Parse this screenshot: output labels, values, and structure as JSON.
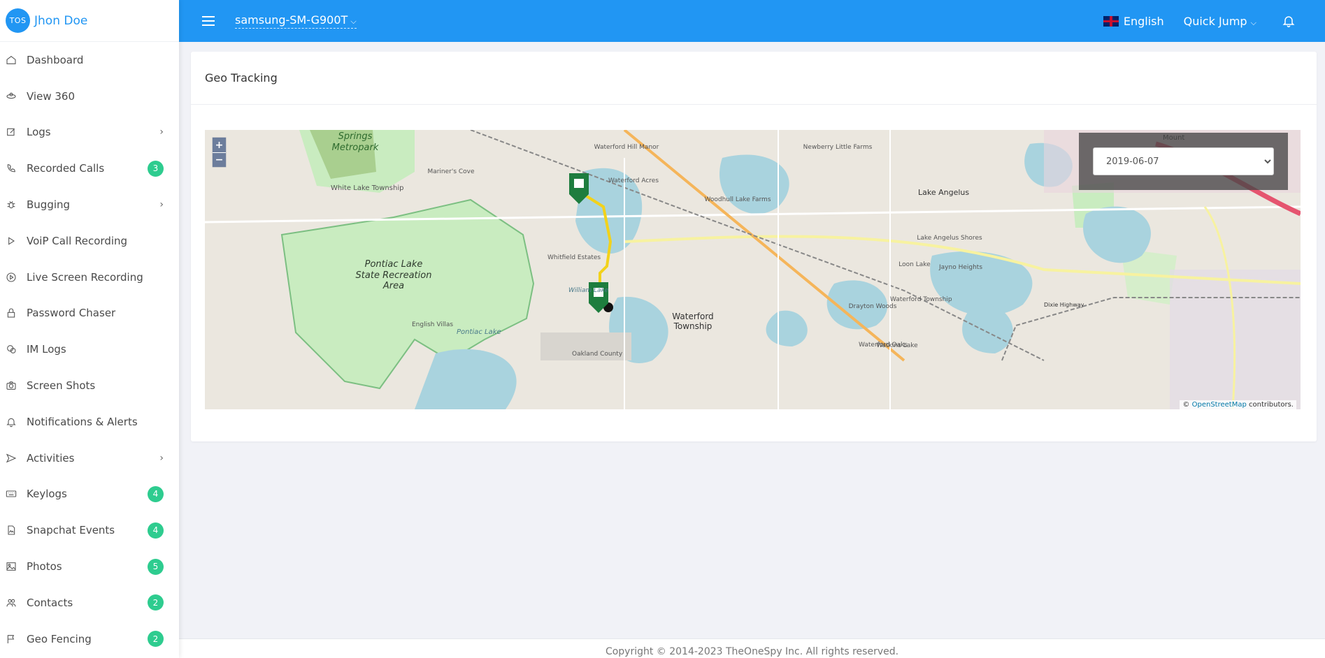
{
  "brand": {
    "logo_text": "TOS",
    "user_name": "Jhon Doe"
  },
  "sidebar": {
    "items": [
      {
        "label": "Dashboard",
        "icon": "home-icon",
        "badge": "",
        "arrow": false
      },
      {
        "label": "View 360",
        "icon": "view360-icon",
        "badge": "",
        "arrow": false
      },
      {
        "label": "Logs",
        "icon": "edit-icon",
        "badge": "",
        "arrow": true
      },
      {
        "label": "Recorded Calls",
        "icon": "phone-icon",
        "badge": "3",
        "arrow": false
      },
      {
        "label": "Bugging",
        "icon": "bug-icon",
        "badge": "",
        "arrow": true
      },
      {
        "label": "VoiP Call Recording",
        "icon": "play-icon",
        "badge": "",
        "arrow": false
      },
      {
        "label": "Live Screen Recording",
        "icon": "play-circle-icon",
        "badge": "",
        "arrow": false
      },
      {
        "label": "Password Chaser",
        "icon": "lock-icon",
        "badge": "",
        "arrow": false
      },
      {
        "label": "IM Logs",
        "icon": "chat-icon",
        "badge": "",
        "arrow": false
      },
      {
        "label": "Screen Shots",
        "icon": "camera-icon",
        "badge": "",
        "arrow": false
      },
      {
        "label": "Notifications & Alerts",
        "icon": "bell-icon",
        "badge": "",
        "arrow": false
      },
      {
        "label": "Activities",
        "icon": "send-icon",
        "badge": "",
        "arrow": true
      },
      {
        "label": "Keylogs",
        "icon": "keyboard-icon",
        "badge": "4",
        "arrow": false
      },
      {
        "label": "Snapchat Events",
        "icon": "file-image-icon",
        "badge": "4",
        "arrow": false
      },
      {
        "label": "Photos",
        "icon": "image-icon",
        "badge": "5",
        "arrow": false
      },
      {
        "label": "Contacts",
        "icon": "users-icon",
        "badge": "2",
        "arrow": false
      },
      {
        "label": "Geo Fencing",
        "icon": "flag-icon",
        "badge": "2",
        "arrow": false
      }
    ]
  },
  "topbar": {
    "device": "samsung-SM-G900T",
    "language": "English",
    "quick_jump": "Quick Jump"
  },
  "card": {
    "title": "Geo Tracking"
  },
  "map": {
    "zoom_in": "+",
    "zoom_out": "−",
    "date_value": "2019-06-07",
    "attribution_prefix": "©",
    "attribution_link": "OpenStreetMap",
    "attribution_suffix": "contributors.",
    "labels": [
      "Springs Metropark",
      "White Lake Township",
      "Pontiac Lake State Recreation Area",
      "Mariner's Cove",
      "Waterford Hill Manor",
      "Waterford Acres",
      "Whitfield Estates",
      "William Lake",
      "English Villas",
      "Pontiac Lake",
      "Oakland County",
      "Waterford Township",
      "Woodhull Lake Farms",
      "Newberry Little Farms",
      "Lake Angelus",
      "Lake Angelus Shores",
      "Loon Lake",
      "Jayno Heights",
      "Drayton Woods",
      "Watkins Lake",
      "Waterford Oaks",
      "Dixie Highway",
      "Mount",
      "Waterford Township"
    ],
    "colors": {
      "park": "#c9ecc0",
      "water": "#a9d3de",
      "route": "#f2d21b",
      "marker": "#1e7d3e"
    }
  },
  "footer": {
    "text": "Copyright © 2014-2023 TheOneSpy Inc. All rights reserved."
  }
}
